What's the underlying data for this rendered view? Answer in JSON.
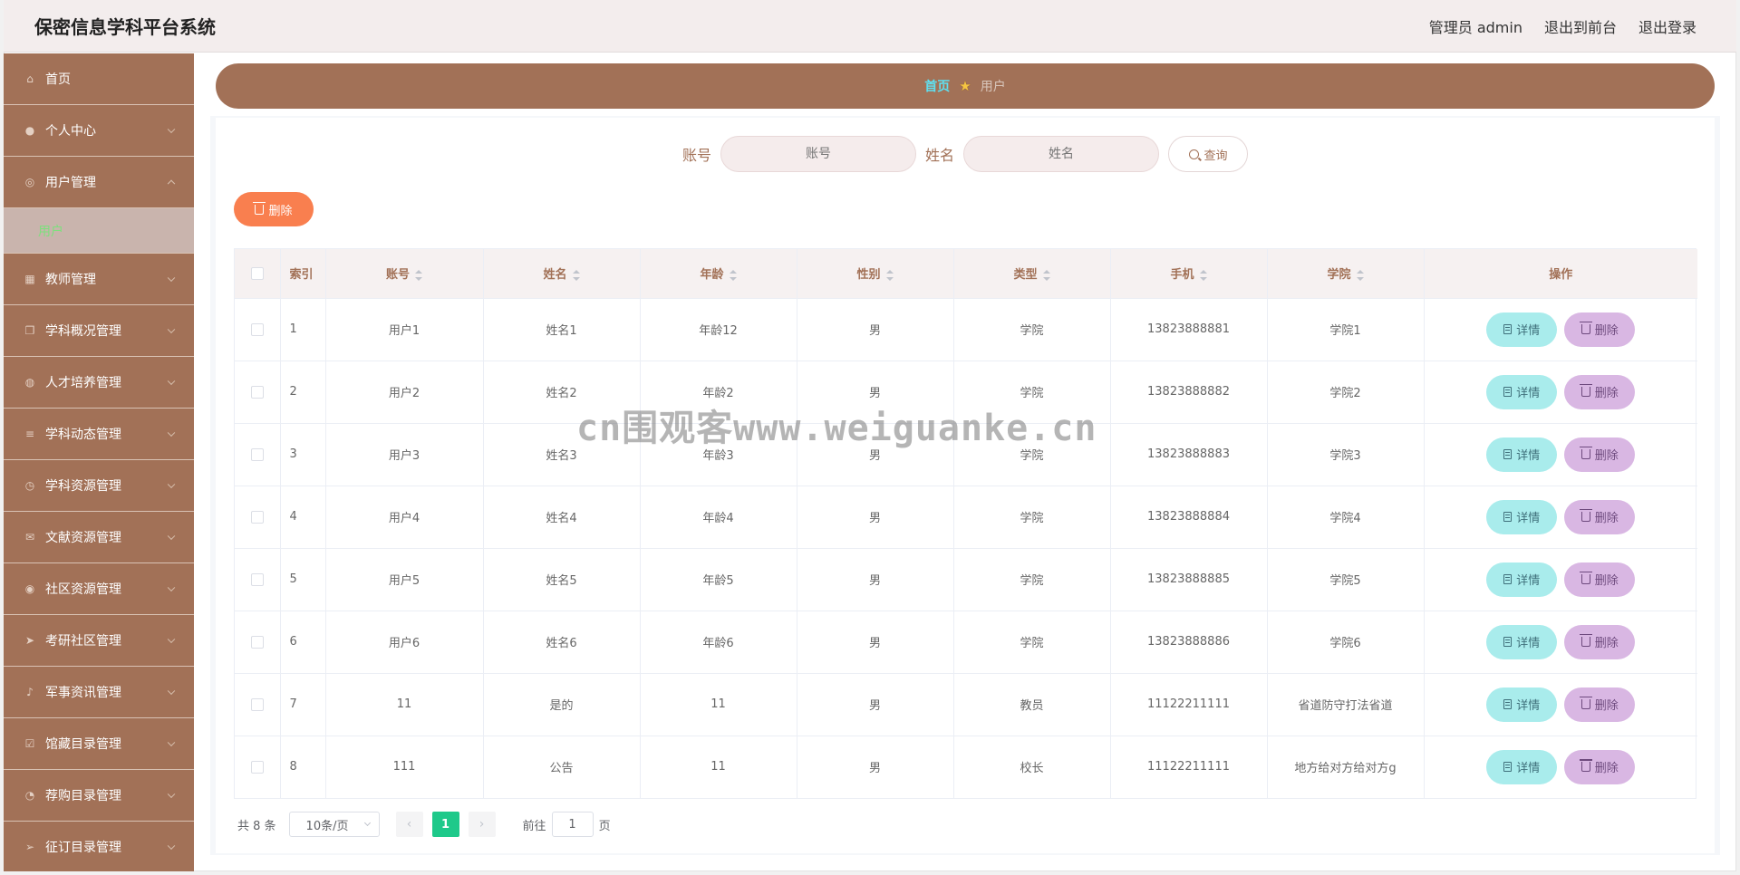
{
  "header": {
    "title": "保密信息学科平台系统",
    "user": "管理员 admin",
    "to_front": "退出到前台",
    "logout": "退出登录"
  },
  "sidebar": {
    "items": [
      {
        "label": "首页",
        "icon": "home-icon"
      },
      {
        "label": "个人中心",
        "icon": "user-icon"
      },
      {
        "label": "用户管理",
        "icon": "users-icon",
        "expanded": true
      },
      {
        "label": "教师管理",
        "icon": "grid-icon"
      },
      {
        "label": "学科概况管理",
        "icon": "copy-icon"
      },
      {
        "label": "人才培养管理",
        "icon": "palette-icon"
      },
      {
        "label": "学科动态管理",
        "icon": "list-icon"
      },
      {
        "label": "学科资源管理",
        "icon": "clock-icon"
      },
      {
        "label": "文献资源管理",
        "icon": "mail-icon"
      },
      {
        "label": "社区资源管理",
        "icon": "compass-icon"
      },
      {
        "label": "考研社区管理",
        "icon": "send-icon"
      },
      {
        "label": "军事资讯管理",
        "icon": "mic-icon"
      },
      {
        "label": "馆藏目录管理",
        "icon": "checkbox-icon"
      },
      {
        "label": "荐购目录管理",
        "icon": "speed-icon"
      },
      {
        "label": "征订目录管理",
        "icon": "location-icon"
      }
    ],
    "submenu": {
      "label": "用户"
    }
  },
  "breadcrumb": {
    "home": "首页",
    "current": "用户",
    "separator": "★"
  },
  "search": {
    "account_label": "账号",
    "account_placeholder": "账号",
    "name_label": "姓名",
    "name_placeholder": "姓名",
    "query_button": "查询"
  },
  "toolbar": {
    "delete_label": "删除"
  },
  "table": {
    "headers": [
      "索引",
      "账号",
      "姓名",
      "年龄",
      "性别",
      "类型",
      "手机",
      "学院",
      "操作"
    ],
    "rows": [
      {
        "index": "1",
        "account": "用户1",
        "name": "姓名1",
        "age": "年龄12",
        "gender": "男",
        "type": "学院",
        "phone": "13823888881",
        "college": "学院1"
      },
      {
        "index": "2",
        "account": "用户2",
        "name": "姓名2",
        "age": "年龄2",
        "gender": "男",
        "type": "学院",
        "phone": "13823888882",
        "college": "学院2"
      },
      {
        "index": "3",
        "account": "用户3",
        "name": "姓名3",
        "age": "年龄3",
        "gender": "男",
        "type": "学院",
        "phone": "13823888883",
        "college": "学院3"
      },
      {
        "index": "4",
        "account": "用户4",
        "name": "姓名4",
        "age": "年龄4",
        "gender": "男",
        "type": "学院",
        "phone": "13823888884",
        "college": "学院4"
      },
      {
        "index": "5",
        "account": "用户5",
        "name": "姓名5",
        "age": "年龄5",
        "gender": "男",
        "type": "学院",
        "phone": "13823888885",
        "college": "学院5"
      },
      {
        "index": "6",
        "account": "用户6",
        "name": "姓名6",
        "age": "年龄6",
        "gender": "男",
        "type": "学院",
        "phone": "13823888886",
        "college": "学院6"
      },
      {
        "index": "7",
        "account": "11",
        "name": "是的",
        "age": "11",
        "gender": "男",
        "type": "教员",
        "phone": "11122211111",
        "college": "省道防守打法省道"
      },
      {
        "index": "8",
        "account": "111",
        "name": "公告",
        "age": "11",
        "gender": "男",
        "type": "校长",
        "phone": "11122211111",
        "college": "地方给对方给对方g"
      }
    ],
    "detail_label": "详情",
    "delete_label": "删除"
  },
  "pagination": {
    "total": "共 8 条",
    "page_size": "10条/页",
    "current": "1",
    "goto_label": "前往",
    "goto_value": "1",
    "page_unit": "页"
  },
  "watermark": "cn围观客www.weiguanke.cn",
  "colors": {
    "sidebar": "#a27157",
    "accent_orange": "#f97f4f",
    "detail_button": "#a9ecec",
    "delete_button": "#d9b7e3",
    "pager_active": "#1ec98a"
  }
}
